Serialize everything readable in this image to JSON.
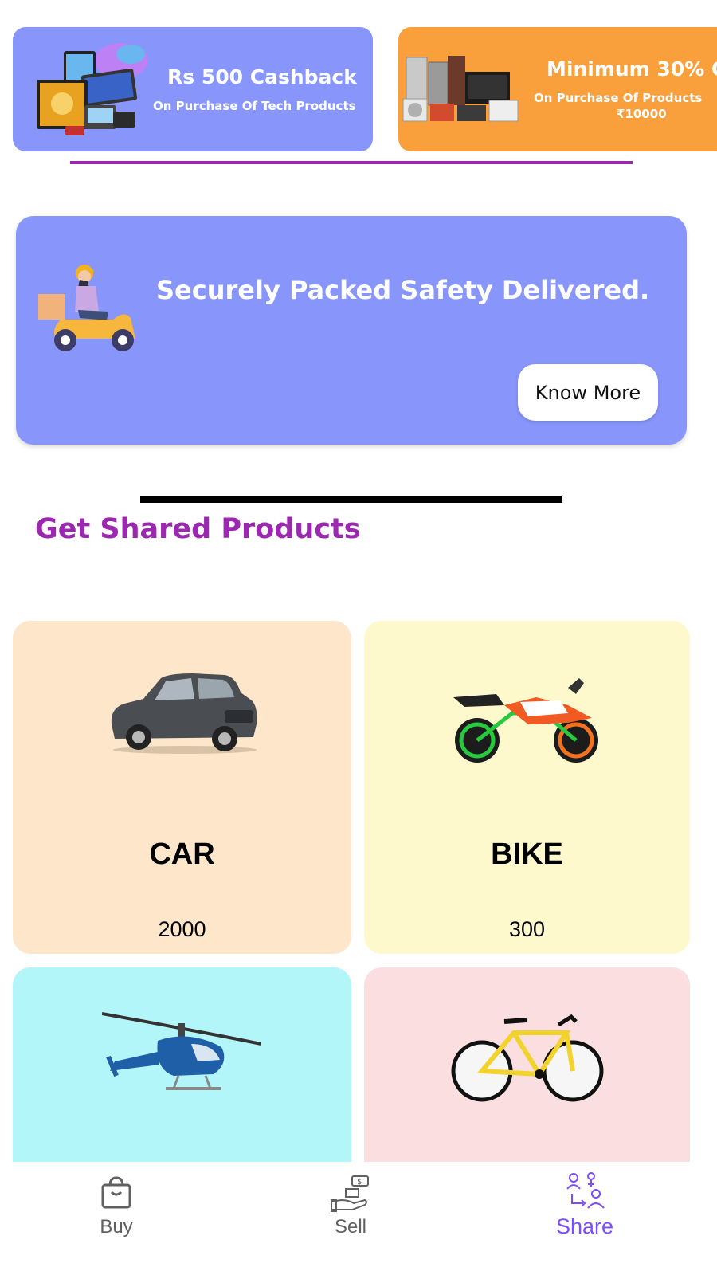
{
  "offers": [
    {
      "title": "Rs 500 Cashback",
      "subtitle": "On Purchase Of Tech Products",
      "bg": "#8896fc"
    },
    {
      "title": "Minimum 30% O",
      "subtitle_line1": "On Purchase Of Products",
      "subtitle_line2": "₹10000",
      "bg": "#f9a03c"
    }
  ],
  "delivery_banner": {
    "text": "Securely Packed Safety Delivered.",
    "button_label": "Know More",
    "bg": "#8896fc"
  },
  "section": {
    "title": "Get Shared Products",
    "title_color": "#9c27b0"
  },
  "products": [
    {
      "name": "CAR",
      "count": "2000",
      "bg": "#fde6c9"
    },
    {
      "name": "BIKE",
      "count": "300",
      "bg": "#fef9cc"
    },
    {
      "name": "",
      "count": "",
      "bg": "#b2f6fa"
    },
    {
      "name": "",
      "count": "",
      "bg": "#fbdfe0"
    }
  ],
  "bottom_nav": {
    "items": [
      {
        "label": "Buy",
        "icon": "shopping-bag-icon",
        "active": false
      },
      {
        "label": "Sell",
        "icon": "hand-money-icon",
        "active": false
      },
      {
        "label": "Share",
        "icon": "share-people-icon",
        "active": true
      }
    ],
    "active_color": "#7c4dff",
    "inactive_color": "#616161"
  }
}
